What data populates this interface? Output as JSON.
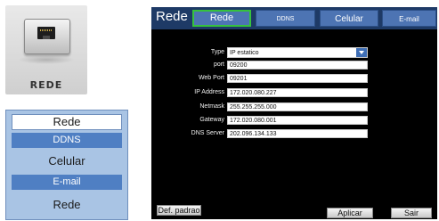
{
  "icon_tile": {
    "label": "REDE",
    "icon": "ethernet-port-icon"
  },
  "side_menu": {
    "items": [
      {
        "label": "Rede"
      },
      {
        "label": "DDNS"
      },
      {
        "label": "Celular"
      },
      {
        "label": "E-mail"
      },
      {
        "label": "Rede"
      }
    ]
  },
  "dialog": {
    "title": "Rede",
    "tabs": [
      "Rede",
      "DDNS",
      "Celular",
      "E-mail"
    ],
    "fields": {
      "type": {
        "label": "Type",
        "value": "IP estatico"
      },
      "port": {
        "label": "port",
        "value": "09200"
      },
      "web_port": {
        "label": "Web Port",
        "value": "09201"
      },
      "ip_address": {
        "label": "IP Address",
        "value": "172.020.080.227"
      },
      "netmask": {
        "label": "Netmask",
        "value": "255.255.255.000"
      },
      "gateway": {
        "label": "Gateway",
        "value": "172.020.080.001"
      },
      "dns_server": {
        "label": "DNS Server",
        "value": "202.096.134.133"
      }
    },
    "buttons": {
      "default": "Def. padrao",
      "apply": "Aplicar",
      "exit": "Sair"
    }
  },
  "colors": {
    "dialog_background": "#000000",
    "titlebar": "#1e3a66",
    "tab": "#4d74b3",
    "active_tab_border": "#36c23d",
    "menu_panel": "#a9c4e4",
    "menu_highlight": "#4f7fc3"
  }
}
